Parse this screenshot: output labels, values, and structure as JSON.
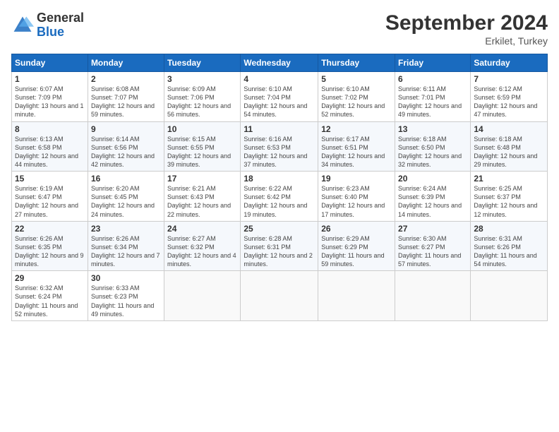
{
  "logo": {
    "general": "General",
    "blue": "Blue"
  },
  "header": {
    "title": "September 2024",
    "location": "Erkilet, Turkey"
  },
  "weekdays": [
    "Sunday",
    "Monday",
    "Tuesday",
    "Wednesday",
    "Thursday",
    "Friday",
    "Saturday"
  ],
  "weeks": [
    [
      {
        "day": "1",
        "sunrise": "6:07 AM",
        "sunset": "7:09 PM",
        "daylight": "13 hours and 1 minute."
      },
      {
        "day": "2",
        "sunrise": "6:08 AM",
        "sunset": "7:07 PM",
        "daylight": "12 hours and 59 minutes."
      },
      {
        "day": "3",
        "sunrise": "6:09 AM",
        "sunset": "7:06 PM",
        "daylight": "12 hours and 56 minutes."
      },
      {
        "day": "4",
        "sunrise": "6:10 AM",
        "sunset": "7:04 PM",
        "daylight": "12 hours and 54 minutes."
      },
      {
        "day": "5",
        "sunrise": "6:10 AM",
        "sunset": "7:02 PM",
        "daylight": "12 hours and 52 minutes."
      },
      {
        "day": "6",
        "sunrise": "6:11 AM",
        "sunset": "7:01 PM",
        "daylight": "12 hours and 49 minutes."
      },
      {
        "day": "7",
        "sunrise": "6:12 AM",
        "sunset": "6:59 PM",
        "daylight": "12 hours and 47 minutes."
      }
    ],
    [
      {
        "day": "8",
        "sunrise": "6:13 AM",
        "sunset": "6:58 PM",
        "daylight": "12 hours and 44 minutes."
      },
      {
        "day": "9",
        "sunrise": "6:14 AM",
        "sunset": "6:56 PM",
        "daylight": "12 hours and 42 minutes."
      },
      {
        "day": "10",
        "sunrise": "6:15 AM",
        "sunset": "6:55 PM",
        "daylight": "12 hours and 39 minutes."
      },
      {
        "day": "11",
        "sunrise": "6:16 AM",
        "sunset": "6:53 PM",
        "daylight": "12 hours and 37 minutes."
      },
      {
        "day": "12",
        "sunrise": "6:17 AM",
        "sunset": "6:51 PM",
        "daylight": "12 hours and 34 minutes."
      },
      {
        "day": "13",
        "sunrise": "6:18 AM",
        "sunset": "6:50 PM",
        "daylight": "12 hours and 32 minutes."
      },
      {
        "day": "14",
        "sunrise": "6:18 AM",
        "sunset": "6:48 PM",
        "daylight": "12 hours and 29 minutes."
      }
    ],
    [
      {
        "day": "15",
        "sunrise": "6:19 AM",
        "sunset": "6:47 PM",
        "daylight": "12 hours and 27 minutes."
      },
      {
        "day": "16",
        "sunrise": "6:20 AM",
        "sunset": "6:45 PM",
        "daylight": "12 hours and 24 minutes."
      },
      {
        "day": "17",
        "sunrise": "6:21 AM",
        "sunset": "6:43 PM",
        "daylight": "12 hours and 22 minutes."
      },
      {
        "day": "18",
        "sunrise": "6:22 AM",
        "sunset": "6:42 PM",
        "daylight": "12 hours and 19 minutes."
      },
      {
        "day": "19",
        "sunrise": "6:23 AM",
        "sunset": "6:40 PM",
        "daylight": "12 hours and 17 minutes."
      },
      {
        "day": "20",
        "sunrise": "6:24 AM",
        "sunset": "6:39 PM",
        "daylight": "12 hours and 14 minutes."
      },
      {
        "day": "21",
        "sunrise": "6:25 AM",
        "sunset": "6:37 PM",
        "daylight": "12 hours and 12 minutes."
      }
    ],
    [
      {
        "day": "22",
        "sunrise": "6:26 AM",
        "sunset": "6:35 PM",
        "daylight": "12 hours and 9 minutes."
      },
      {
        "day": "23",
        "sunrise": "6:26 AM",
        "sunset": "6:34 PM",
        "daylight": "12 hours and 7 minutes."
      },
      {
        "day": "24",
        "sunrise": "6:27 AM",
        "sunset": "6:32 PM",
        "daylight": "12 hours and 4 minutes."
      },
      {
        "day": "25",
        "sunrise": "6:28 AM",
        "sunset": "6:31 PM",
        "daylight": "12 hours and 2 minutes."
      },
      {
        "day": "26",
        "sunrise": "6:29 AM",
        "sunset": "6:29 PM",
        "daylight": "11 hours and 59 minutes."
      },
      {
        "day": "27",
        "sunrise": "6:30 AM",
        "sunset": "6:27 PM",
        "daylight": "11 hours and 57 minutes."
      },
      {
        "day": "28",
        "sunrise": "6:31 AM",
        "sunset": "6:26 PM",
        "daylight": "11 hours and 54 minutes."
      }
    ],
    [
      {
        "day": "29",
        "sunrise": "6:32 AM",
        "sunset": "6:24 PM",
        "daylight": "11 hours and 52 minutes."
      },
      {
        "day": "30",
        "sunrise": "6:33 AM",
        "sunset": "6:23 PM",
        "daylight": "11 hours and 49 minutes."
      },
      null,
      null,
      null,
      null,
      null
    ]
  ],
  "labels": {
    "sunrise": "Sunrise:",
    "sunset": "Sunset:",
    "daylight": "Daylight:"
  }
}
